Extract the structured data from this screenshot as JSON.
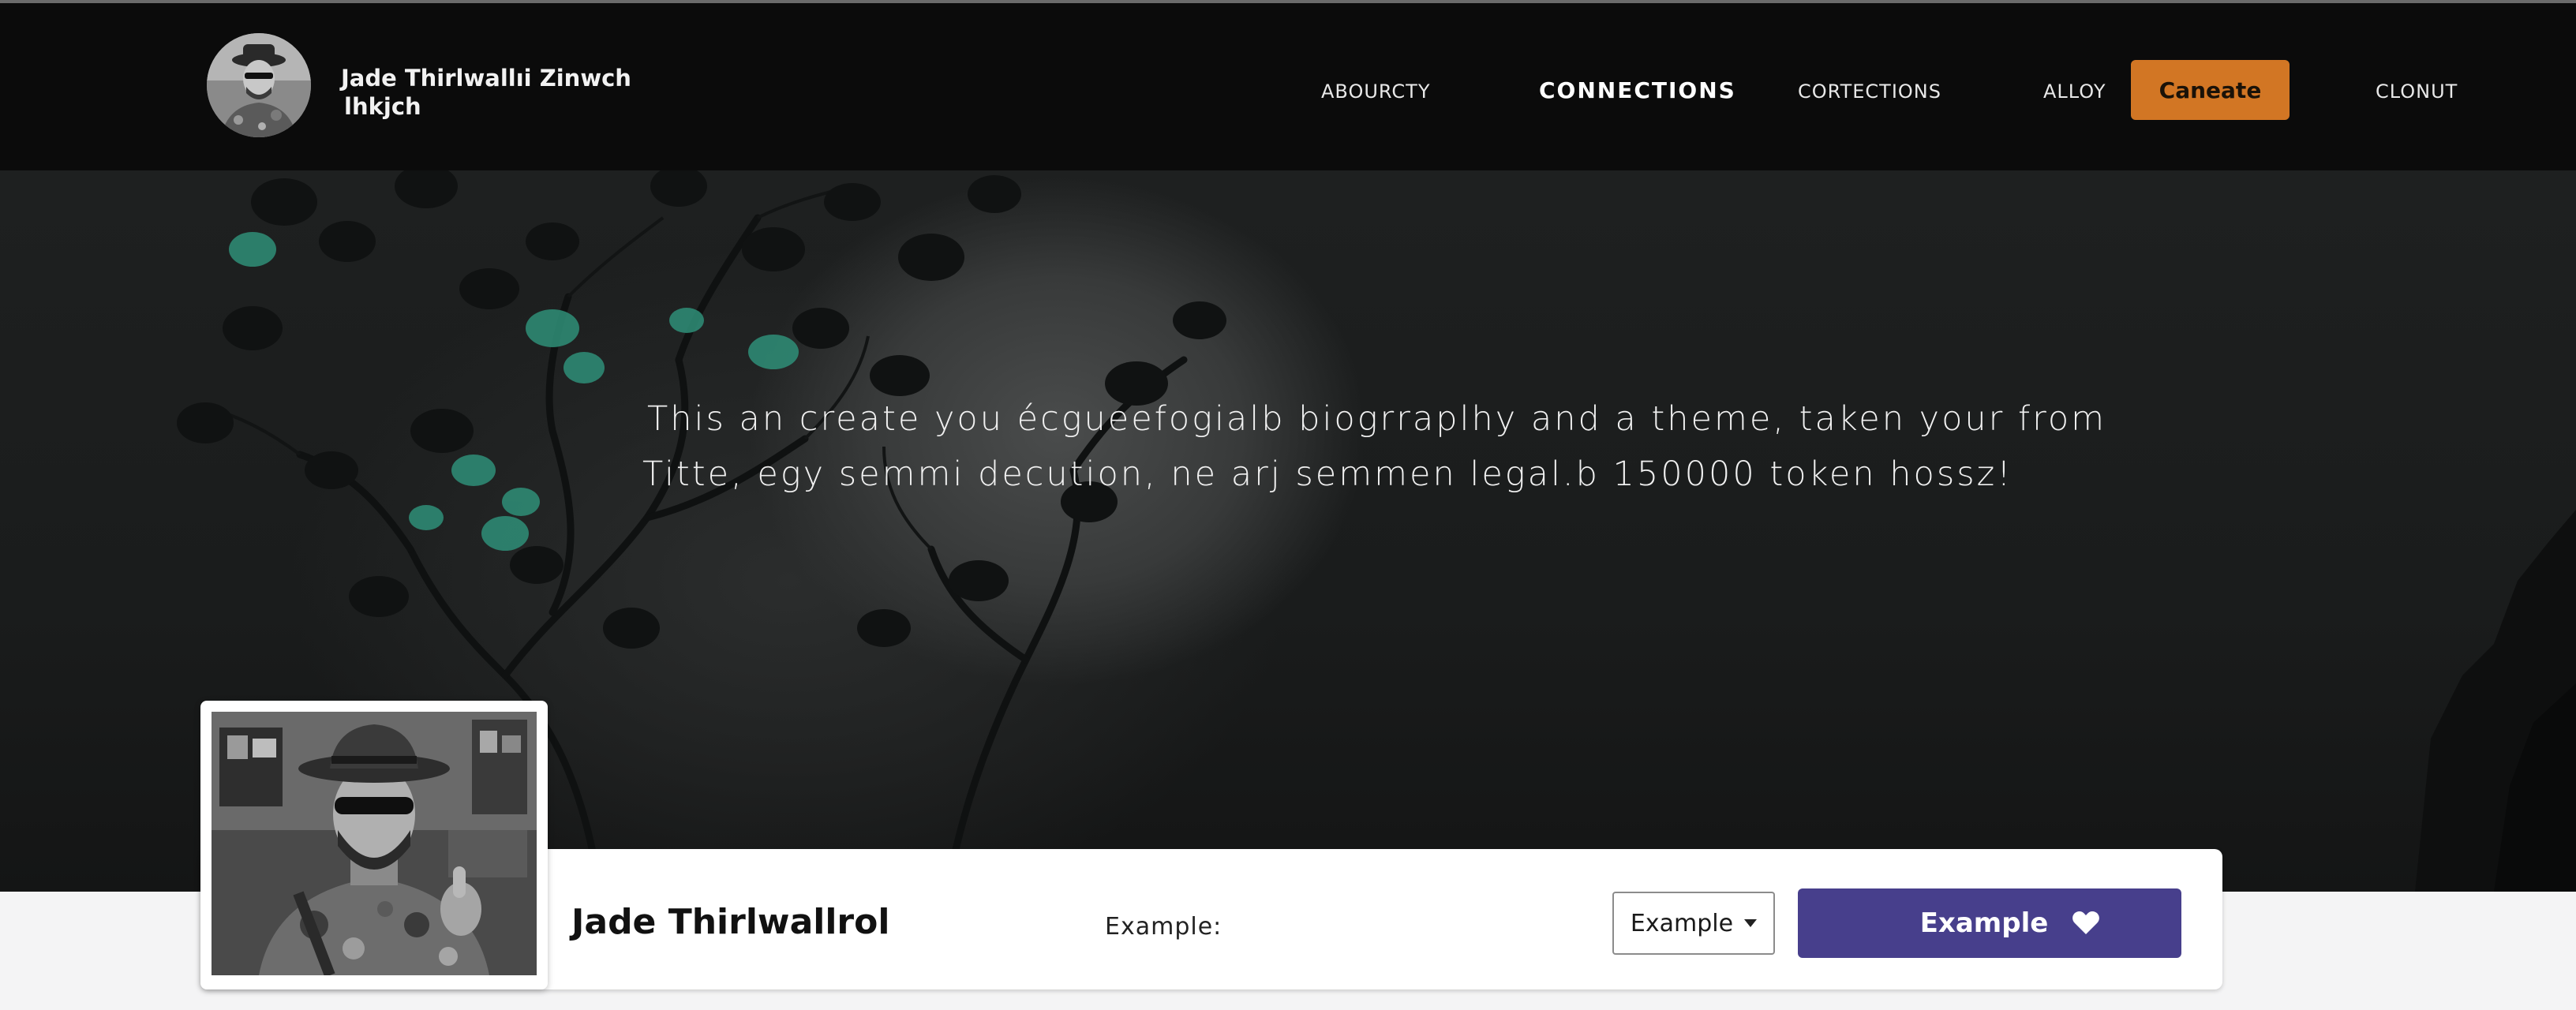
{
  "header": {
    "brand_line1": "Jade Thirlwallıi Zinwch",
    "brand_line2": "lhkjch",
    "nav": [
      {
        "label": "ABOURCTY"
      },
      {
        "label": "CONNECTIONS"
      },
      {
        "label": "CORTECTIONS"
      },
      {
        "label": "ALLOY"
      },
      {
        "label": "Caneate"
      },
      {
        "label": "CLONUT"
      }
    ],
    "active_nav": "CONNECTIONS"
  },
  "hero": {
    "line1": "This an create you écgueefogialb biogrraplhy and a theme, taken your from",
    "line2": "Titte, egy semmi decution, ne arj semmen legal.b 150000 token hossz!"
  },
  "profile": {
    "name": "Jade Thirlwallrol",
    "example_label": "Example:",
    "select_value": "Example",
    "button_label": "Example",
    "button_icon": "heart-icon"
  },
  "colors": {
    "header_bg": "#0b0b0b",
    "cta_orange": "#d27624",
    "button_purple": "#473f8c",
    "hero_leaf_accent": "#2f8f78"
  }
}
